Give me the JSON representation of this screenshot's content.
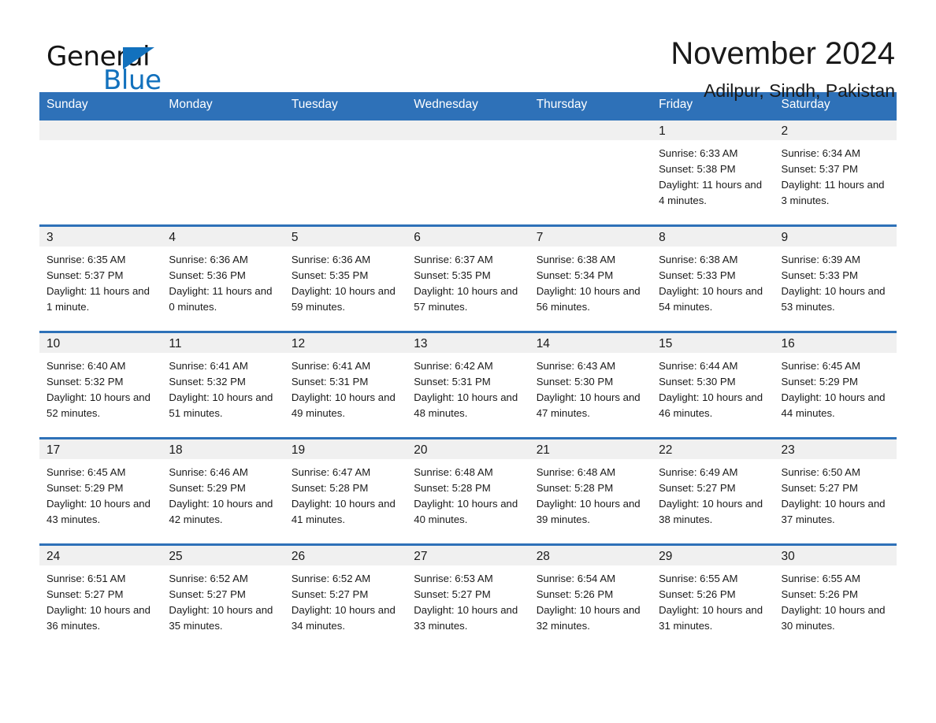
{
  "brand": {
    "name_part1": "General",
    "name_part2": "Blue",
    "triangle_color": "#1271bd",
    "logo_icon": "general-blue-triangle-icon"
  },
  "header": {
    "title": "November 2024",
    "subtitle": "Adilpur, Sindh, Pakistan"
  },
  "theme": {
    "header_blue": "#2e71b8",
    "daynum_strip_gray": "#f0f0f0",
    "text_color": "#1a1a1a"
  },
  "weekday_headers": [
    "Sunday",
    "Monday",
    "Tuesday",
    "Wednesday",
    "Thursday",
    "Friday",
    "Saturday"
  ],
  "weeks": [
    [
      {
        "day": "",
        "sunrise": "",
        "sunset": "",
        "daylight": ""
      },
      {
        "day": "",
        "sunrise": "",
        "sunset": "",
        "daylight": ""
      },
      {
        "day": "",
        "sunrise": "",
        "sunset": "",
        "daylight": ""
      },
      {
        "day": "",
        "sunrise": "",
        "sunset": "",
        "daylight": ""
      },
      {
        "day": "",
        "sunrise": "",
        "sunset": "",
        "daylight": ""
      },
      {
        "day": "1",
        "sunrise": "Sunrise: 6:33 AM",
        "sunset": "Sunset: 5:38 PM",
        "daylight": "Daylight: 11 hours and 4 minutes."
      },
      {
        "day": "2",
        "sunrise": "Sunrise: 6:34 AM",
        "sunset": "Sunset: 5:37 PM",
        "daylight": "Daylight: 11 hours and 3 minutes."
      }
    ],
    [
      {
        "day": "3",
        "sunrise": "Sunrise: 6:35 AM",
        "sunset": "Sunset: 5:37 PM",
        "daylight": "Daylight: 11 hours and 1 minute."
      },
      {
        "day": "4",
        "sunrise": "Sunrise: 6:36 AM",
        "sunset": "Sunset: 5:36 PM",
        "daylight": "Daylight: 11 hours and 0 minutes."
      },
      {
        "day": "5",
        "sunrise": "Sunrise: 6:36 AM",
        "sunset": "Sunset: 5:35 PM",
        "daylight": "Daylight: 10 hours and 59 minutes."
      },
      {
        "day": "6",
        "sunrise": "Sunrise: 6:37 AM",
        "sunset": "Sunset: 5:35 PM",
        "daylight": "Daylight: 10 hours and 57 minutes."
      },
      {
        "day": "7",
        "sunrise": "Sunrise: 6:38 AM",
        "sunset": "Sunset: 5:34 PM",
        "daylight": "Daylight: 10 hours and 56 minutes."
      },
      {
        "day": "8",
        "sunrise": "Sunrise: 6:38 AM",
        "sunset": "Sunset: 5:33 PM",
        "daylight": "Daylight: 10 hours and 54 minutes."
      },
      {
        "day": "9",
        "sunrise": "Sunrise: 6:39 AM",
        "sunset": "Sunset: 5:33 PM",
        "daylight": "Daylight: 10 hours and 53 minutes."
      }
    ],
    [
      {
        "day": "10",
        "sunrise": "Sunrise: 6:40 AM",
        "sunset": "Sunset: 5:32 PM",
        "daylight": "Daylight: 10 hours and 52 minutes."
      },
      {
        "day": "11",
        "sunrise": "Sunrise: 6:41 AM",
        "sunset": "Sunset: 5:32 PM",
        "daylight": "Daylight: 10 hours and 51 minutes."
      },
      {
        "day": "12",
        "sunrise": "Sunrise: 6:41 AM",
        "sunset": "Sunset: 5:31 PM",
        "daylight": "Daylight: 10 hours and 49 minutes."
      },
      {
        "day": "13",
        "sunrise": "Sunrise: 6:42 AM",
        "sunset": "Sunset: 5:31 PM",
        "daylight": "Daylight: 10 hours and 48 minutes."
      },
      {
        "day": "14",
        "sunrise": "Sunrise: 6:43 AM",
        "sunset": "Sunset: 5:30 PM",
        "daylight": "Daylight: 10 hours and 47 minutes."
      },
      {
        "day": "15",
        "sunrise": "Sunrise: 6:44 AM",
        "sunset": "Sunset: 5:30 PM",
        "daylight": "Daylight: 10 hours and 46 minutes."
      },
      {
        "day": "16",
        "sunrise": "Sunrise: 6:45 AM",
        "sunset": "Sunset: 5:29 PM",
        "daylight": "Daylight: 10 hours and 44 minutes."
      }
    ],
    [
      {
        "day": "17",
        "sunrise": "Sunrise: 6:45 AM",
        "sunset": "Sunset: 5:29 PM",
        "daylight": "Daylight: 10 hours and 43 minutes."
      },
      {
        "day": "18",
        "sunrise": "Sunrise: 6:46 AM",
        "sunset": "Sunset: 5:29 PM",
        "daylight": "Daylight: 10 hours and 42 minutes."
      },
      {
        "day": "19",
        "sunrise": "Sunrise: 6:47 AM",
        "sunset": "Sunset: 5:28 PM",
        "daylight": "Daylight: 10 hours and 41 minutes."
      },
      {
        "day": "20",
        "sunrise": "Sunrise: 6:48 AM",
        "sunset": "Sunset: 5:28 PM",
        "daylight": "Daylight: 10 hours and 40 minutes."
      },
      {
        "day": "21",
        "sunrise": "Sunrise: 6:48 AM",
        "sunset": "Sunset: 5:28 PM",
        "daylight": "Daylight: 10 hours and 39 minutes."
      },
      {
        "day": "22",
        "sunrise": "Sunrise: 6:49 AM",
        "sunset": "Sunset: 5:27 PM",
        "daylight": "Daylight: 10 hours and 38 minutes."
      },
      {
        "day": "23",
        "sunrise": "Sunrise: 6:50 AM",
        "sunset": "Sunset: 5:27 PM",
        "daylight": "Daylight: 10 hours and 37 minutes."
      }
    ],
    [
      {
        "day": "24",
        "sunrise": "Sunrise: 6:51 AM",
        "sunset": "Sunset: 5:27 PM",
        "daylight": "Daylight: 10 hours and 36 minutes."
      },
      {
        "day": "25",
        "sunrise": "Sunrise: 6:52 AM",
        "sunset": "Sunset: 5:27 PM",
        "daylight": "Daylight: 10 hours and 35 minutes."
      },
      {
        "day": "26",
        "sunrise": "Sunrise: 6:52 AM",
        "sunset": "Sunset: 5:27 PM",
        "daylight": "Daylight: 10 hours and 34 minutes."
      },
      {
        "day": "27",
        "sunrise": "Sunrise: 6:53 AM",
        "sunset": "Sunset: 5:27 PM",
        "daylight": "Daylight: 10 hours and 33 minutes."
      },
      {
        "day": "28",
        "sunrise": "Sunrise: 6:54 AM",
        "sunset": "Sunset: 5:26 PM",
        "daylight": "Daylight: 10 hours and 32 minutes."
      },
      {
        "day": "29",
        "sunrise": "Sunrise: 6:55 AM",
        "sunset": "Sunset: 5:26 PM",
        "daylight": "Daylight: 10 hours and 31 minutes."
      },
      {
        "day": "30",
        "sunrise": "Sunrise: 6:55 AM",
        "sunset": "Sunset: 5:26 PM",
        "daylight": "Daylight: 10 hours and 30 minutes."
      }
    ]
  ]
}
